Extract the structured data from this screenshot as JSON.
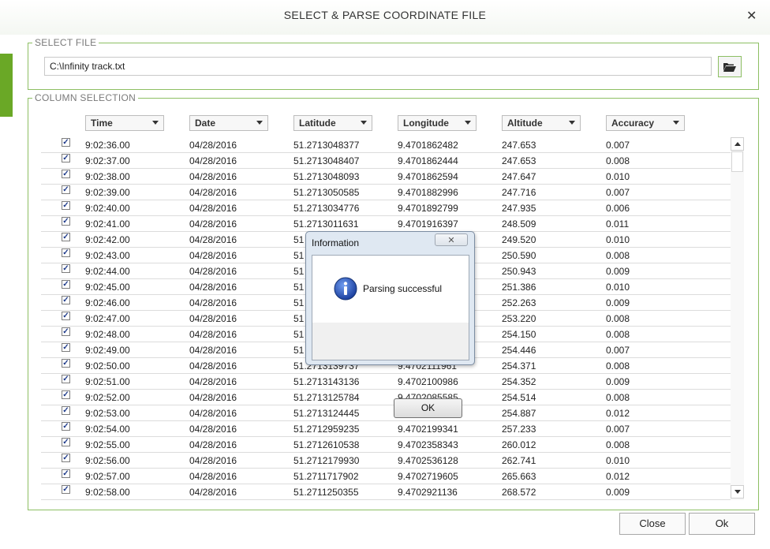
{
  "window": {
    "title": "SELECT & PARSE COORDINATE FILE",
    "close_glyph": "✕"
  },
  "select_file": {
    "legend": "SELECT FILE",
    "path": "C:\\Infinity track.txt"
  },
  "column_selection": {
    "legend": "COLUMN SELECTION",
    "columns": [
      "Time",
      "Date",
      "Latitude",
      "Longitude",
      "Altitude",
      "Accuracy"
    ],
    "rows": [
      {
        "checked": true,
        "cells": [
          "9:02:36.00",
          "04/28/2016",
          "51.2713048377",
          "9.4701862482",
          "247.653",
          "0.007"
        ]
      },
      {
        "checked": true,
        "cells": [
          "9:02:37.00",
          "04/28/2016",
          "51.2713048407",
          "9.4701862444",
          "247.653",
          "0.008"
        ]
      },
      {
        "checked": true,
        "cells": [
          "9:02:38.00",
          "04/28/2016",
          "51.2713048093",
          "9.4701862594",
          "247.647",
          "0.010"
        ]
      },
      {
        "checked": true,
        "cells": [
          "9:02:39.00",
          "04/28/2016",
          "51.2713050585",
          "9.4701882996",
          "247.716",
          "0.007"
        ]
      },
      {
        "checked": true,
        "cells": [
          "9:02:40.00",
          "04/28/2016",
          "51.2713034776",
          "9.4701892799",
          "247.935",
          "0.006"
        ]
      },
      {
        "checked": true,
        "cells": [
          "9:02:41.00",
          "04/28/2016",
          "51.2713011631",
          "9.4701916397",
          "248.509",
          "0.011"
        ]
      },
      {
        "checked": true,
        "cells": [
          "9:02:42.00",
          "04/28/2016",
          "51",
          "",
          "249.520",
          "0.010"
        ]
      },
      {
        "checked": true,
        "cells": [
          "9:02:43.00",
          "04/28/2016",
          "51",
          "",
          "250.590",
          "0.008"
        ]
      },
      {
        "checked": true,
        "cells": [
          "9:02:44.00",
          "04/28/2016",
          "51",
          "",
          "250.943",
          "0.009"
        ]
      },
      {
        "checked": true,
        "cells": [
          "9:02:45.00",
          "04/28/2016",
          "51",
          "",
          "251.386",
          "0.010"
        ]
      },
      {
        "checked": true,
        "cells": [
          "9:02:46.00",
          "04/28/2016",
          "51",
          "",
          "252.263",
          "0.009"
        ]
      },
      {
        "checked": true,
        "cells": [
          "9:02:47.00",
          "04/28/2016",
          "51",
          "",
          "253.220",
          "0.008"
        ]
      },
      {
        "checked": true,
        "cells": [
          "9:02:48.00",
          "04/28/2016",
          "51",
          "",
          "254.150",
          "0.008"
        ]
      },
      {
        "checked": true,
        "cells": [
          "9:02:49.00",
          "04/28/2016",
          "51",
          "",
          "254.446",
          "0.007"
        ]
      },
      {
        "checked": true,
        "cells": [
          "9:02:50.00",
          "04/28/2016",
          "51.2713139737",
          "9.4702111961",
          "254.371",
          "0.008"
        ]
      },
      {
        "checked": true,
        "cells": [
          "9:02:51.00",
          "04/28/2016",
          "51.2713143136",
          "9.4702100986",
          "254.352",
          "0.009"
        ]
      },
      {
        "checked": true,
        "cells": [
          "9:02:52.00",
          "04/28/2016",
          "51.2713125784",
          "9.4702085585",
          "254.514",
          "0.008"
        ]
      },
      {
        "checked": true,
        "cells": [
          "9:02:53.00",
          "04/28/2016",
          "51.2713124445",
          "9.4702110856",
          "254.887",
          "0.012"
        ]
      },
      {
        "checked": true,
        "cells": [
          "9:02:54.00",
          "04/28/2016",
          "51.2712959235",
          "9.4702199341",
          "257.233",
          "0.007"
        ]
      },
      {
        "checked": true,
        "cells": [
          "9:02:55.00",
          "04/28/2016",
          "51.2712610538",
          "9.4702358343",
          "260.012",
          "0.008"
        ]
      },
      {
        "checked": true,
        "cells": [
          "9:02:56.00",
          "04/28/2016",
          "51.2712179930",
          "9.4702536128",
          "262.741",
          "0.010"
        ]
      },
      {
        "checked": true,
        "cells": [
          "9:02:57.00",
          "04/28/2016",
          "51.2711717902",
          "9.4702719605",
          "265.663",
          "0.012"
        ]
      },
      {
        "checked": true,
        "cells": [
          "9:02:58.00",
          "04/28/2016",
          "51.2711250355",
          "9.4702921136",
          "268.572",
          "0.009"
        ]
      }
    ]
  },
  "footer": {
    "close_label": "Close",
    "ok_label": "Ok"
  },
  "dialog": {
    "title": "Information",
    "message": "Parsing successful",
    "ok_label": "OK",
    "close_glyph": "✕"
  },
  "icons": {
    "browse": "folder-open-icon",
    "info": "info-icon"
  },
  "colors": {
    "accent": "#6aa826",
    "group_border": "#8dbf63",
    "info_blue": "#1f4fb0"
  }
}
